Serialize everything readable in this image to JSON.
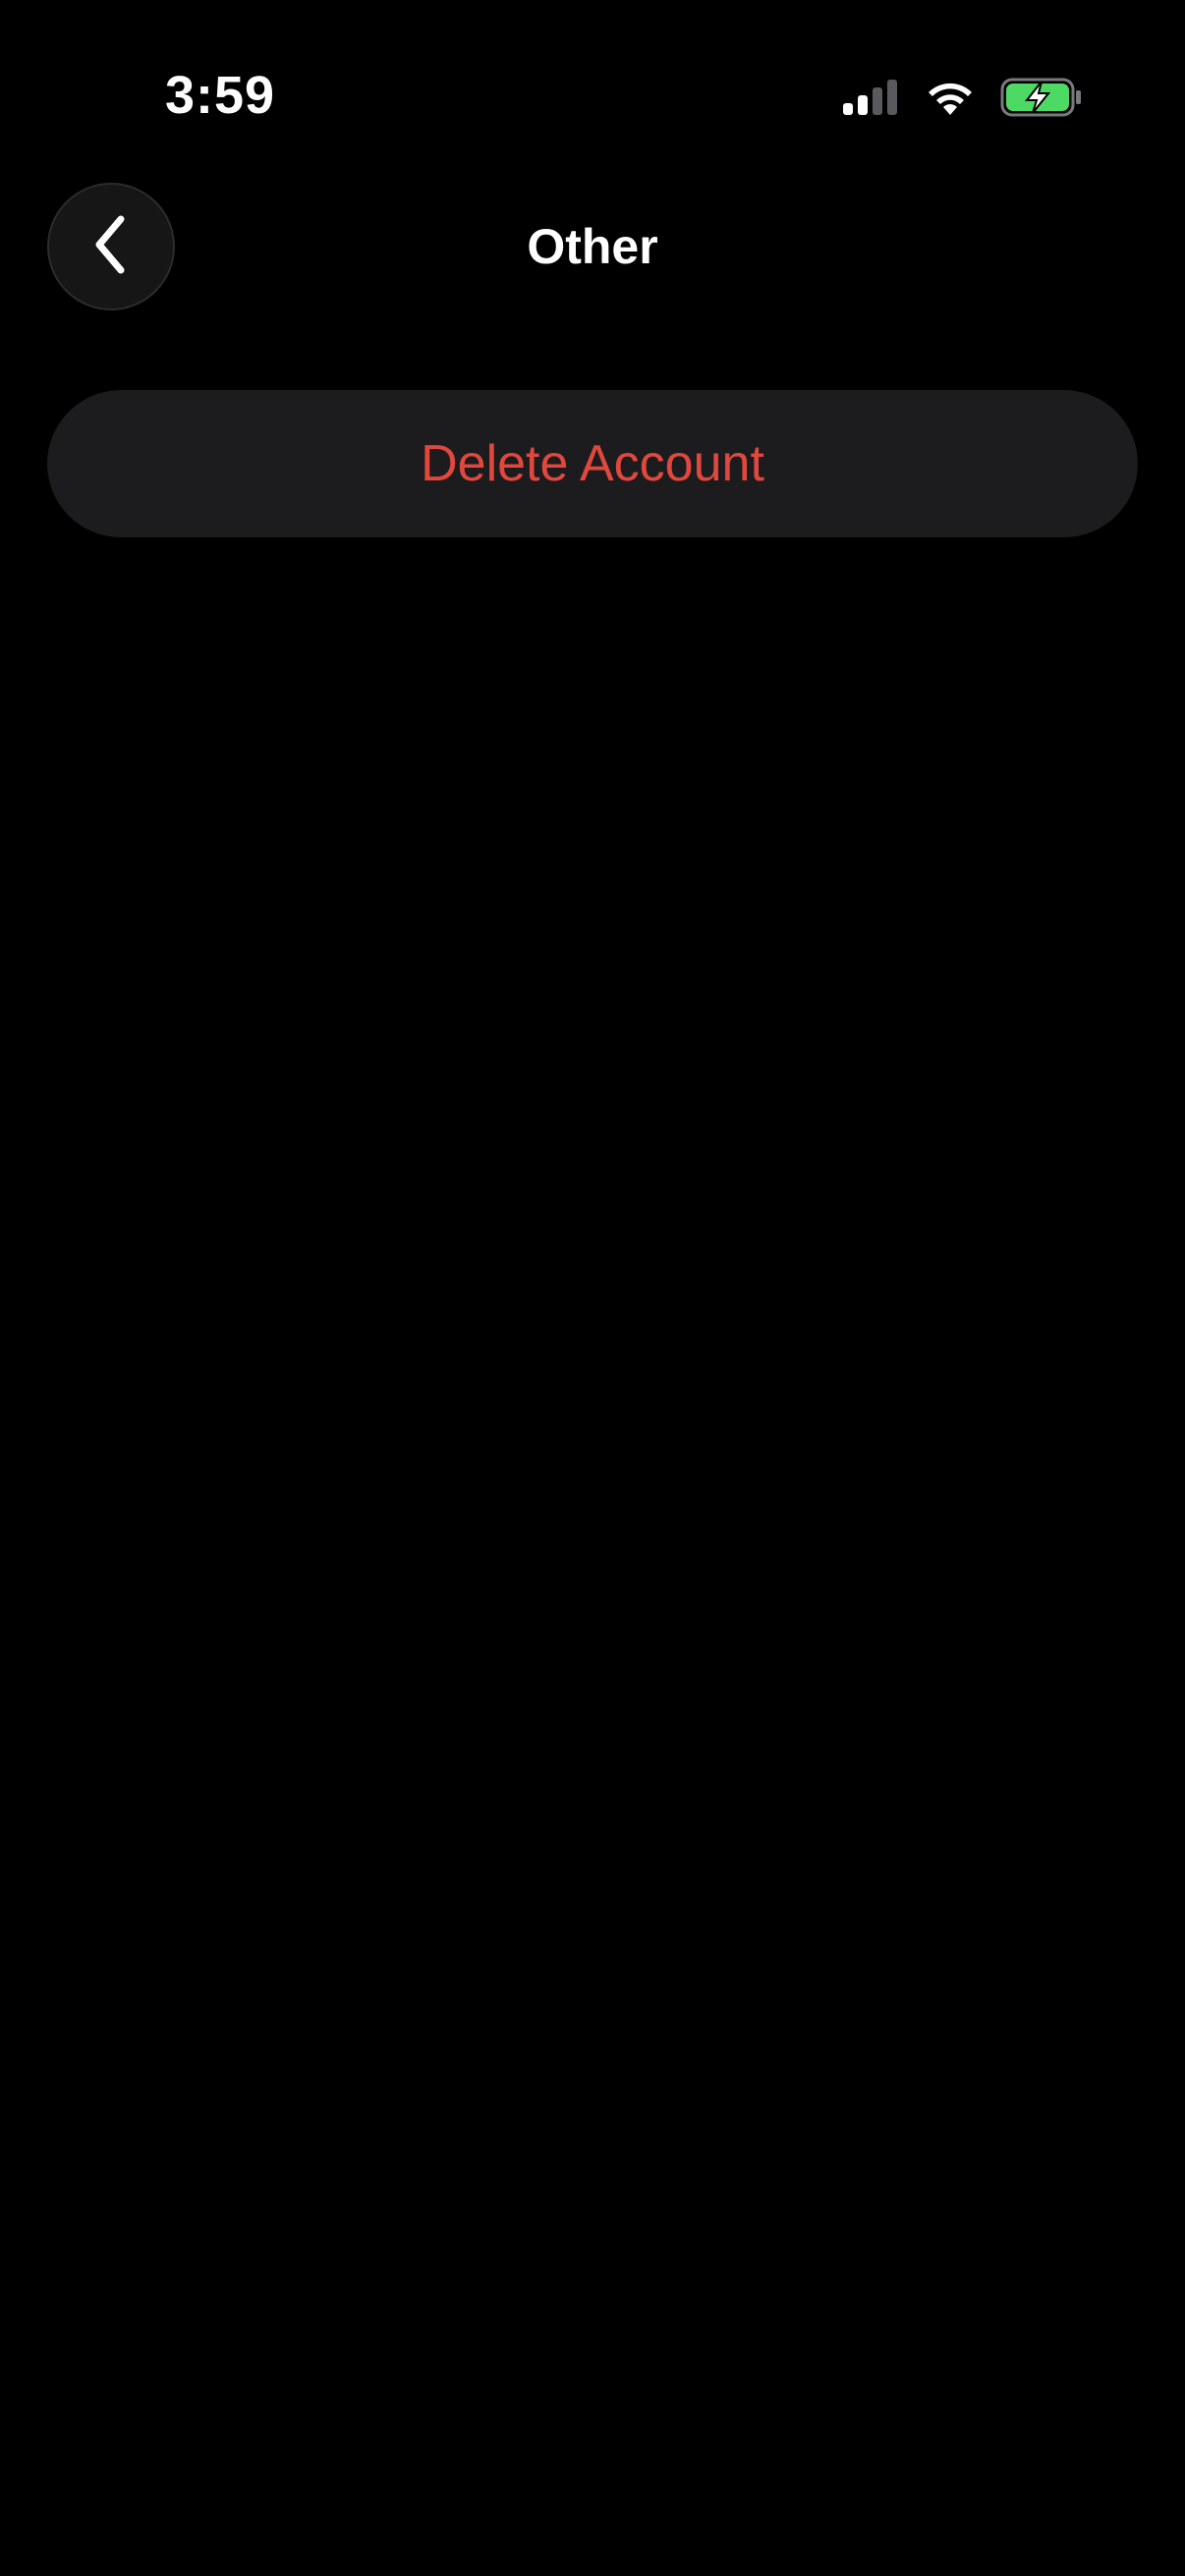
{
  "status_bar": {
    "time": "3:59",
    "signal_icon": "cellular-signal-icon",
    "wifi_icon": "wifi-icon",
    "battery_icon": "battery-charging-icon",
    "battery_color": "#4cd964"
  },
  "nav": {
    "back_icon": "chevron-left-icon",
    "title": "Other"
  },
  "actions": {
    "delete_account_label": "Delete Account",
    "delete_color": "#e0483e"
  }
}
